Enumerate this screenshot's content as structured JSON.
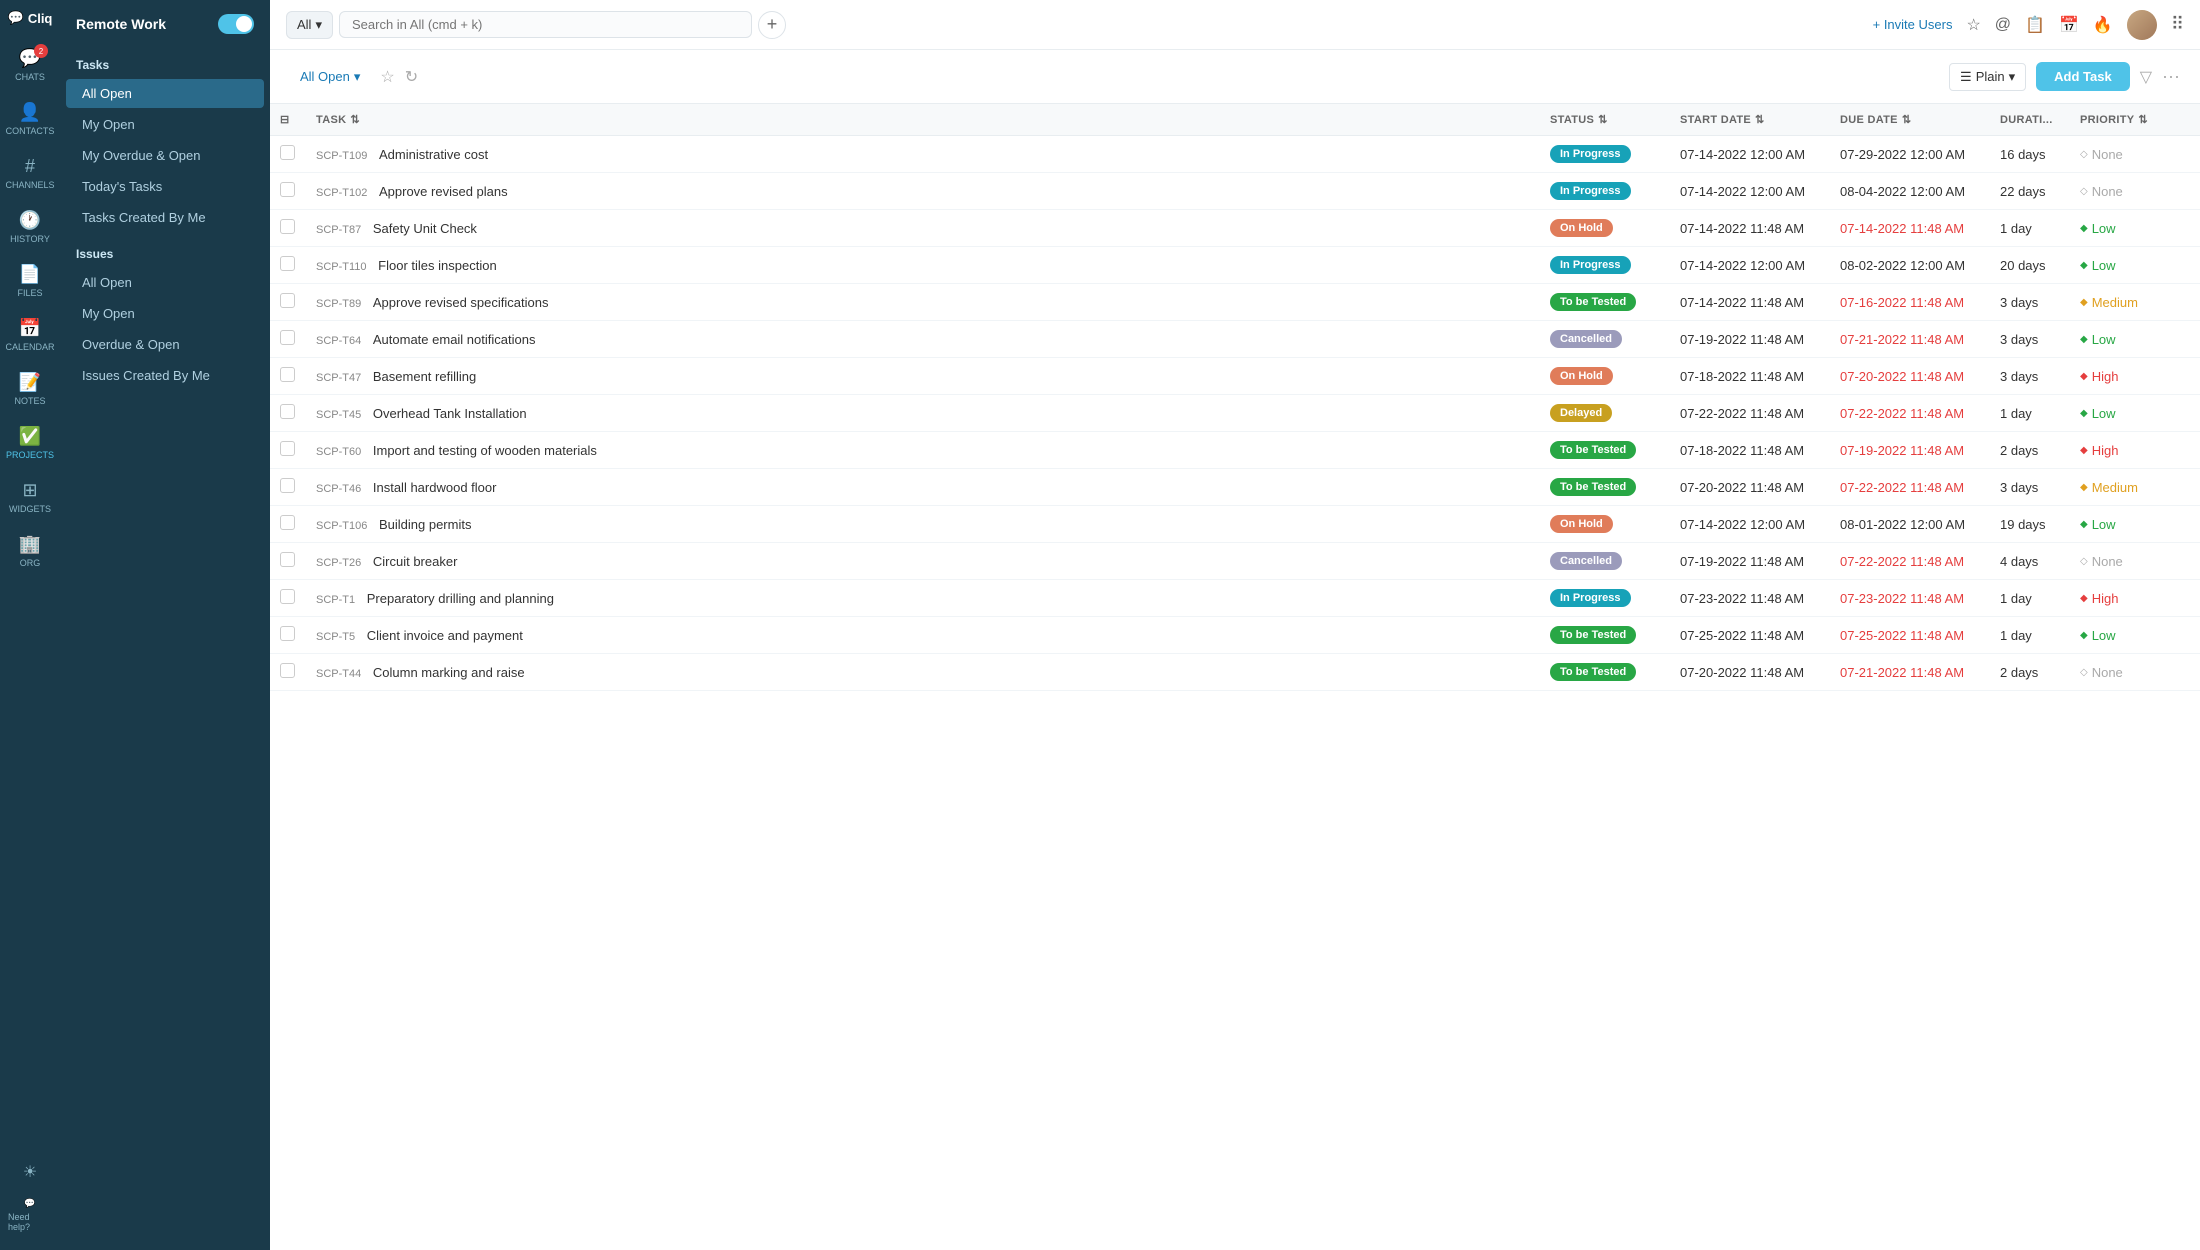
{
  "app": {
    "name": "Cliq",
    "logo_icon": "💬"
  },
  "nav": {
    "items": [
      {
        "id": "chats",
        "label": "CHATS",
        "icon": "💬",
        "badge": "2",
        "active": false
      },
      {
        "id": "contacts",
        "label": "CONTACTS",
        "icon": "👤",
        "badge": null,
        "active": false
      },
      {
        "id": "channels",
        "label": "CHANNELS",
        "icon": "#",
        "badge": null,
        "active": false
      },
      {
        "id": "history",
        "label": "HISTORY",
        "icon": "🕐",
        "badge": null,
        "active": false
      },
      {
        "id": "files",
        "label": "FILES",
        "icon": "📄",
        "badge": null,
        "active": false
      },
      {
        "id": "calendar",
        "label": "CALENDAR",
        "icon": "📅",
        "badge": null,
        "active": false
      },
      {
        "id": "notes",
        "label": "NOTES",
        "icon": "📝",
        "badge": null,
        "active": false
      },
      {
        "id": "projects",
        "label": "PROJECTS",
        "icon": "✅",
        "badge": null,
        "active": true
      },
      {
        "id": "widgets",
        "label": "WIDGETS",
        "icon": "⊞",
        "badge": null,
        "active": false
      },
      {
        "id": "org",
        "label": "ORG",
        "icon": "🏢",
        "badge": null,
        "active": false
      }
    ],
    "help_label": "Need help?"
  },
  "sidebar": {
    "workspace_title": "Remote Work",
    "tasks_label": "Tasks",
    "tasks_items": [
      {
        "id": "all-open",
        "label": "All Open",
        "active": true
      },
      {
        "id": "my-open",
        "label": "My Open",
        "active": false
      },
      {
        "id": "my-overdue",
        "label": "My Overdue & Open",
        "active": false
      },
      {
        "id": "todays-tasks",
        "label": "Today's Tasks",
        "active": false
      },
      {
        "id": "tasks-created-by-me",
        "label": "Tasks Created By Me",
        "active": false
      }
    ],
    "issues_label": "Issues",
    "issues_items": [
      {
        "id": "issues-all-open",
        "label": "All Open",
        "active": false
      },
      {
        "id": "issues-my-open",
        "label": "My Open",
        "active": false
      },
      {
        "id": "issues-overdue",
        "label": "Overdue & Open",
        "active": false
      },
      {
        "id": "issues-created-by-me",
        "label": "Issues Created By Me",
        "active": false
      }
    ]
  },
  "topbar": {
    "search_scope": "All",
    "search_placeholder": "Search in All (cmd + k)",
    "invite_users_label": "+ Invite Users"
  },
  "task_area": {
    "filter_label": "All Open",
    "plain_label": "Plain",
    "add_task_label": "Add Task",
    "columns": [
      {
        "id": "task",
        "label": "TASK"
      },
      {
        "id": "status",
        "label": "STATUS"
      },
      {
        "id": "start_date",
        "label": "START DATE"
      },
      {
        "id": "due_date",
        "label": "DUE DATE"
      },
      {
        "id": "duration",
        "label": "DURATI..."
      },
      {
        "id": "priority",
        "label": "PRIORITY"
      }
    ],
    "tasks": [
      {
        "id": "SCP-T109",
        "name": "Administrative cost",
        "status": "In Progress",
        "status_class": "status-in-progress",
        "start_date": "07-14-2022 12:00 AM",
        "due_date": "07-29-2022 12:00 AM",
        "due_overdue": false,
        "duration": "16 days",
        "priority": "None",
        "priority_class": "priority-none"
      },
      {
        "id": "SCP-T102",
        "name": "Approve revised plans",
        "status": "In Progress",
        "status_class": "status-in-progress",
        "start_date": "07-14-2022 12:00 AM",
        "due_date": "08-04-2022 12:00 AM",
        "due_overdue": false,
        "duration": "22 days",
        "priority": "None",
        "priority_class": "priority-none"
      },
      {
        "id": "SCP-T87",
        "name": "Safety Unit Check",
        "status": "On Hold",
        "status_class": "status-on-hold",
        "start_date": "07-14-2022 11:48 AM",
        "due_date": "07-14-2022 11:48 AM",
        "due_overdue": true,
        "duration": "1 day",
        "priority": "Low",
        "priority_class": "priority-low"
      },
      {
        "id": "SCP-T110",
        "name": "Floor tiles inspection",
        "status": "In Progress",
        "status_class": "status-in-progress",
        "start_date": "07-14-2022 12:00 AM",
        "due_date": "08-02-2022 12:00 AM",
        "due_overdue": false,
        "duration": "20 days",
        "priority": "Low",
        "priority_class": "priority-low"
      },
      {
        "id": "SCP-T89",
        "name": "Approve revised specifications",
        "status": "To be Tested",
        "status_class": "status-to-be-tested",
        "start_date": "07-14-2022 11:48 AM",
        "due_date": "07-16-2022 11:48 AM",
        "due_overdue": true,
        "duration": "3 days",
        "priority": "Medium",
        "priority_class": "priority-medium"
      },
      {
        "id": "SCP-T64",
        "name": "Automate email notifications",
        "status": "Cancelled",
        "status_class": "status-cancelled",
        "start_date": "07-19-2022 11:48 AM",
        "due_date": "07-21-2022 11:48 AM",
        "due_overdue": true,
        "duration": "3 days",
        "priority": "Low",
        "priority_class": "priority-low"
      },
      {
        "id": "SCP-T47",
        "name": "Basement refilling",
        "status": "On Hold",
        "status_class": "status-on-hold",
        "start_date": "07-18-2022 11:48 AM",
        "due_date": "07-20-2022 11:48 AM",
        "due_overdue": true,
        "duration": "3 days",
        "priority": "High",
        "priority_class": "priority-high"
      },
      {
        "id": "SCP-T45",
        "name": "Overhead Tank Installation",
        "status": "Delayed",
        "status_class": "status-delayed",
        "start_date": "07-22-2022 11:48 AM",
        "due_date": "07-22-2022 11:48 AM",
        "due_overdue": true,
        "duration": "1 day",
        "priority": "Low",
        "priority_class": "priority-low"
      },
      {
        "id": "SCP-T60",
        "name": "Import and testing of wooden materials",
        "status": "To be Tested",
        "status_class": "status-to-be-tested",
        "start_date": "07-18-2022 11:48 AM",
        "due_date": "07-19-2022 11:48 AM",
        "due_overdue": true,
        "duration": "2 days",
        "priority": "High",
        "priority_class": "priority-high"
      },
      {
        "id": "SCP-T46",
        "name": "Install hardwood floor",
        "status": "To be Tested",
        "status_class": "status-to-be-tested",
        "start_date": "07-20-2022 11:48 AM",
        "due_date": "07-22-2022 11:48 AM",
        "due_overdue": true,
        "duration": "3 days",
        "priority": "Medium",
        "priority_class": "priority-medium"
      },
      {
        "id": "SCP-T106",
        "name": "Building permits",
        "status": "On Hold",
        "status_class": "status-on-hold",
        "start_date": "07-14-2022 12:00 AM",
        "due_date": "08-01-2022 12:00 AM",
        "due_overdue": false,
        "duration": "19 days",
        "priority": "Low",
        "priority_class": "priority-low"
      },
      {
        "id": "SCP-T26",
        "name": "Circuit breaker",
        "status": "Cancelled",
        "status_class": "status-cancelled",
        "start_date": "07-19-2022 11:48 AM",
        "due_date": "07-22-2022 11:48 AM",
        "due_overdue": true,
        "duration": "4 days",
        "priority": "None",
        "priority_class": "priority-none"
      },
      {
        "id": "SCP-T1",
        "name": "Preparatory drilling and planning",
        "status": "In Progress",
        "status_class": "status-in-progress",
        "start_date": "07-23-2022 11:48 AM",
        "due_date": "07-23-2022 11:48 AM",
        "due_overdue": true,
        "duration": "1 day",
        "priority": "High",
        "priority_class": "priority-high"
      },
      {
        "id": "SCP-T5",
        "name": "Client invoice and payment",
        "status": "To be Tested",
        "status_class": "status-to-be-tested",
        "start_date": "07-25-2022 11:48 AM",
        "due_date": "07-25-2022 11:48 AM",
        "due_overdue": true,
        "duration": "1 day",
        "priority": "Low",
        "priority_class": "priority-low"
      },
      {
        "id": "SCP-T44",
        "name": "Column marking and raise",
        "status": "To be Tested",
        "status_class": "status-to-be-tested",
        "start_date": "07-20-2022 11:48 AM",
        "due_date": "07-21-2022 11:48 AM",
        "due_overdue": true,
        "duration": "2 days",
        "priority": "None",
        "priority_class": "priority-none"
      }
    ]
  }
}
